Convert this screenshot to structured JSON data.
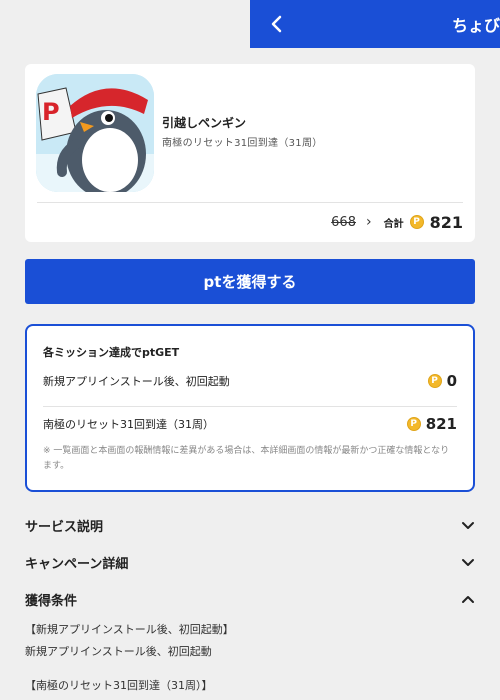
{
  "header": {
    "title": "ちょび",
    "back_icon": "chevron-left-icon",
    "background": "#1a4fd6"
  },
  "app": {
    "name": "引越しペンギン",
    "subtitle": "南極のリセット31回到達（31周）",
    "old_points": "668",
    "total_label": "合計",
    "total_points": "821",
    "coin_symbol": "P"
  },
  "get_button": {
    "label": "ptを獲得する"
  },
  "missions": {
    "title": "各ミッション達成でptGET",
    "items": [
      {
        "label": "新規アプリインストール後、初回起動",
        "points": "0"
      },
      {
        "label": "南極のリセット31回到達（31周）",
        "points": "821"
      }
    ],
    "note": "※ 一覧画面と本画面の報酬情報に差異がある場合は、本詳細画面の情報が最新かつ正確な情報となります。"
  },
  "sections": [
    {
      "title": "サービス説明",
      "state": "collapsed",
      "icon": "chevron-down-icon"
    },
    {
      "title": "キャンペーン詳細",
      "state": "collapsed",
      "icon": "chevron-down-icon"
    },
    {
      "title": "獲得条件",
      "state": "expanded",
      "icon": "chevron-up-icon"
    }
  ],
  "conditions": {
    "line1": "【新規アプリインストール後、初回起動】",
    "line2": "新規アプリインストール後、初回起動",
    "line3": "【南極のリセット31回到達（31周）】"
  },
  "colors": {
    "accent": "#1a4fd6",
    "coin": "#f3b82a",
    "page_bg": "#efefef"
  }
}
